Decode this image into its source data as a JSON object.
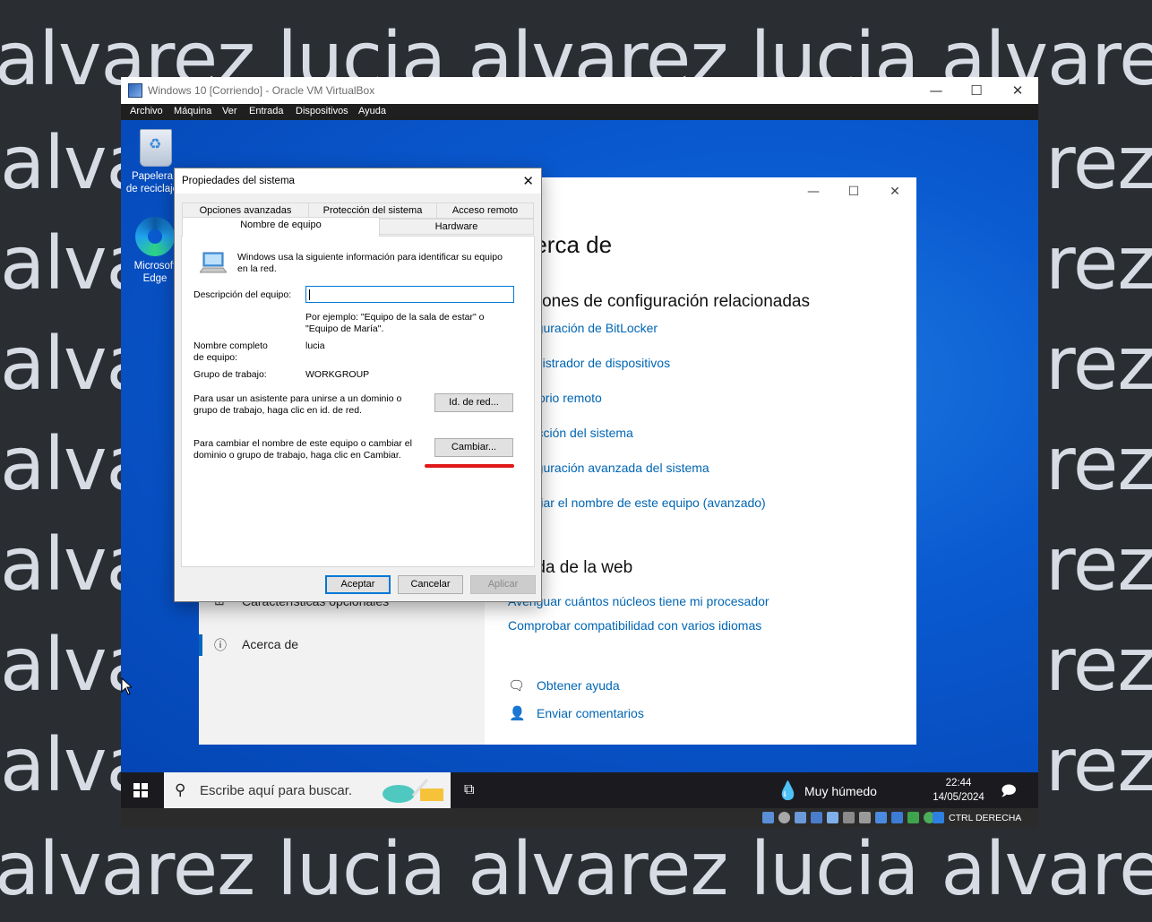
{
  "watermark": {
    "line1": "alvarez lucia alvarez lucia alvarez",
    "side_left": "alva",
    "side_right": "rez"
  },
  "vbox": {
    "title": "Windows 10 [Corriendo] - Oracle VM VirtualBox",
    "controls": {
      "minimize": "—",
      "maximize": "☐",
      "close": "✕"
    },
    "menu": [
      "Archivo",
      "Máquina",
      "Ver",
      "Entrada",
      "Dispositivos",
      "Ayuda"
    ],
    "status_text": "CTRL DERECHA"
  },
  "desktop": {
    "icons": [
      {
        "label": "Papelera de reciclaje",
        "icon": "recycle-bin-icon"
      },
      {
        "label": "Microsoft Edge",
        "icon": "edge-icon"
      }
    ]
  },
  "settings": {
    "controls": {
      "minimize": "—",
      "maximize": "☐",
      "close": "✕"
    },
    "title": "Acerca de",
    "related_heading": "Opciones de configuración relacionadas",
    "related_links": [
      "Configuración de BitLocker",
      "Administrador de dispositivos",
      "Escritorio remoto",
      "Protección del sistema",
      "Configuración avanzada del sistema",
      "Cambiar el nombre de este equipo (avanzado)"
    ],
    "web_heading": "Ayuda de la web",
    "web_links": [
      "Averiguar cuántos núcleos tiene mi procesador",
      "Comprobar compatibilidad con varios idiomas"
    ],
    "help": {
      "get_help": "Obtener ayuda",
      "feedback": "Enviar comentarios"
    },
    "nav": [
      {
        "label": "Características opcionales",
        "icon": "apps-icon"
      },
      {
        "label": "Acerca de",
        "icon": "info-icon",
        "active": true
      }
    ]
  },
  "dialog": {
    "title": "Propiedades del sistema",
    "tabs_top": [
      "Opciones avanzadas",
      "Protección del sistema",
      "Acceso remoto"
    ],
    "tabs_bottom": [
      "Nombre de equipo",
      "Hardware"
    ],
    "intro": "Windows usa la siguiente información para identificar su equipo en la red.",
    "desc_label": "Descripción del equipo:",
    "desc_value": "",
    "example": "Por ejemplo: \"Equipo de la sala de estar\" o \"Equipo de María\".",
    "fullname_label": "Nombre completo de equipo:",
    "fullname_value": "lucia",
    "workgroup_label": "Grupo de trabajo:",
    "workgroup_value": "WORKGROUP",
    "network_text": "Para usar un asistente para unirse a un dominio o grupo de trabajo, haga clic en id. de red.",
    "network_button": "Id. de red...",
    "change_text": "Para cambiar el nombre de este equipo o cambiar el dominio o grupo de trabajo, haga clic en Cambiar.",
    "change_button": "Cambiar...",
    "ok": "Aceptar",
    "cancel": "Cancelar",
    "apply": "Aplicar"
  },
  "taskbar": {
    "search_placeholder": "Escribe aquí para buscar.",
    "weather": "Muy húmedo",
    "time": "22:44",
    "date": "14/05/2024"
  },
  "colors": {
    "accent": "#0067c0",
    "link": "#0066b4",
    "desktop": "#0a5ad0",
    "highlight": "#e01818"
  }
}
